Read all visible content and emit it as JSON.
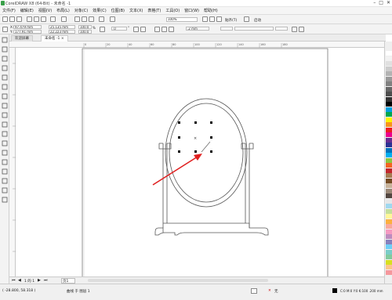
{
  "window": {
    "title": "CorelDRAW X8 (64-Bit) - 未命名 -1",
    "minimize": "–",
    "maximize": "□",
    "close": "✕"
  },
  "menu": [
    "文件(F)",
    "编辑(E)",
    "视图(V)",
    "布局(L)",
    "对象(C)",
    "效果(C)",
    "位图(B)",
    "文本(X)",
    "表格(T)",
    "工具(O)",
    "窗口(W)",
    "帮助(H)"
  ],
  "standard_toolbar": {
    "zoom": "100%",
    "snap_label": "贴齐(T)",
    "launch_label": "启动"
  },
  "property_bar": {
    "x": "97.479 mm",
    "y": "177.91 mm",
    "w": "25.135 mm",
    "h": "22.223 mm",
    "scale_w": "100.0",
    "scale_h": "100.0",
    "pct": "%",
    "rotation": ".0",
    "rotation_unit": "°",
    "outline": ".2 mm"
  },
  "tabs": {
    "welcome": "欢迎屏幕",
    "doc": "未命名 -1"
  },
  "ruler_labels": [
    "0",
    "20",
    "40",
    "60",
    "80",
    "100",
    "120",
    "140",
    "160",
    "180"
  ],
  "docnav": {
    "page_label": "页1",
    "page_count": "1 的 1",
    "page_prefix": "1"
  },
  "status": {
    "coords": "( -28.800, 58.318 )",
    "object_info": "曲线 于 图层 1",
    "fill_none": "无",
    "color_model": "C:0 M:0 Y:0 K:100 .200 mm"
  },
  "palette_colors": [
    "#ffffff",
    "#f2f2f2",
    "#e0e0e0",
    "#cccccc",
    "#b3b3b3",
    "#999999",
    "#808080",
    "#666666",
    "#4d4d4d",
    "#333333",
    "#000000",
    "#00a0e0",
    "#00a651",
    "#fff200",
    "#f7941d",
    "#ed1c24",
    "#ec008c",
    "#662d91",
    "#2e3192",
    "#0072bc",
    "#00aeef",
    "#8dc63f",
    "#f26522",
    "#c1272d",
    "#a67c52",
    "#754c24",
    "#c7b299",
    "#998675",
    "#534741",
    "#e6e7e8",
    "#a0d8ef",
    "#c4df9b",
    "#fff799",
    "#fbb040",
    "#f9a99c",
    "#f49ac1",
    "#bd8cbf",
    "#8781bd",
    "#6dcff6",
    "#7accc8",
    "#82ca9c",
    "#d7e021",
    "#fdc689",
    "#f5989d"
  ],
  "colors": {
    "arrow": "#e02020",
    "outline": "#555555"
  }
}
